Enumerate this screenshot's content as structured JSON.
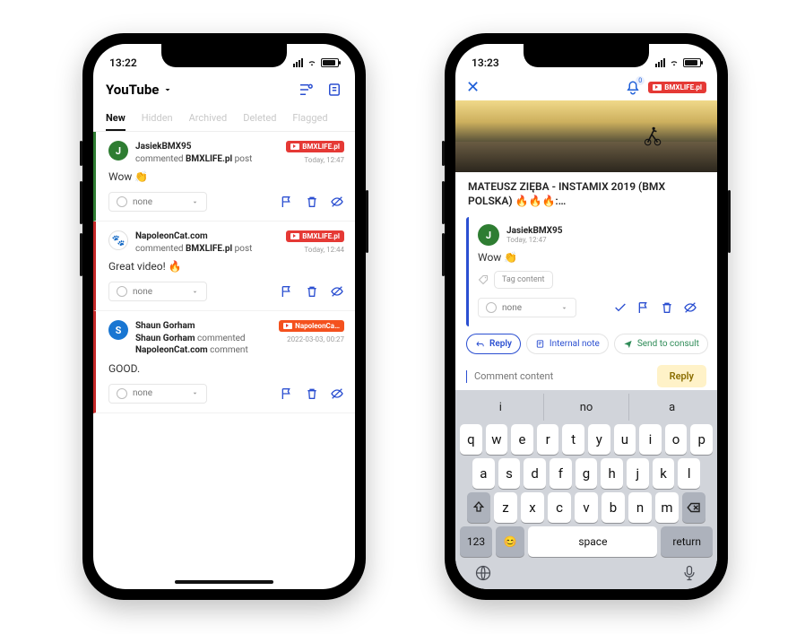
{
  "left": {
    "status_time": "13:22",
    "header_title": "YouTube",
    "tabs": [
      "New",
      "Hidden",
      "Archived",
      "Deleted",
      "Flagged"
    ],
    "items": [
      {
        "avatar_letter": "J",
        "name": "JasiekBMX95",
        "sub_prefix": "commented ",
        "sub_bold": "BMXLIFE.pl",
        "sub_suffix": " post",
        "badge": "BMXLIFE.pl",
        "time": "Today, 12:47",
        "body": "Wow 👏",
        "none": "none"
      },
      {
        "avatar_letter": "🐾",
        "name": "NapoleonCat.com",
        "sub_prefix": "commented ",
        "sub_bold": "BMXLIFE.pl",
        "sub_suffix": " post",
        "badge": "BMXLIFE.pl",
        "time": "Today, 12:44",
        "body": "Great video! 🔥",
        "none": "none"
      },
      {
        "avatar_letter": "S",
        "name": "Shaun Gorham",
        "sub_prefix": "",
        "sub_bold": "Shaun Gorham",
        "sub_suffix": " commented",
        "sub2_bold": "NapoleonCat.com",
        "sub2_suffix": " comment",
        "badge": "NapoleonCa…",
        "time": "2022-03-03, 00:27",
        "body": "GOOD.",
        "none": "none"
      }
    ]
  },
  "right": {
    "status_time": "13:23",
    "badge": "BMXLIFE.pl",
    "video_title": "MATEUSZ ZIĘBA - INSTAMIX 2019 (BMX POLSKA) 🔥🔥🔥:…",
    "comment": {
      "avatar_letter": "J",
      "name": "JasiekBMX95",
      "time": "Today, 12:47",
      "body": "Wow 👏",
      "tag_label": "Tag content",
      "none": "none"
    },
    "pills": {
      "reply": "Reply",
      "note": "Internal note",
      "send": "Send to consult"
    },
    "compose_placeholder": "Comment content",
    "reply_btn": "Reply",
    "suggestions": [
      "i",
      "no",
      "a"
    ],
    "rows": {
      "r1": [
        "q",
        "w",
        "e",
        "r",
        "t",
        "y",
        "u",
        "i",
        "o",
        "p"
      ],
      "r2": [
        "a",
        "s",
        "d",
        "f",
        "g",
        "h",
        "j",
        "k",
        "l"
      ],
      "r3": [
        "z",
        "x",
        "c",
        "v",
        "b",
        "n",
        "m"
      ]
    },
    "meta_keys": {
      "num": "123",
      "space": "space",
      "return": "return"
    }
  }
}
